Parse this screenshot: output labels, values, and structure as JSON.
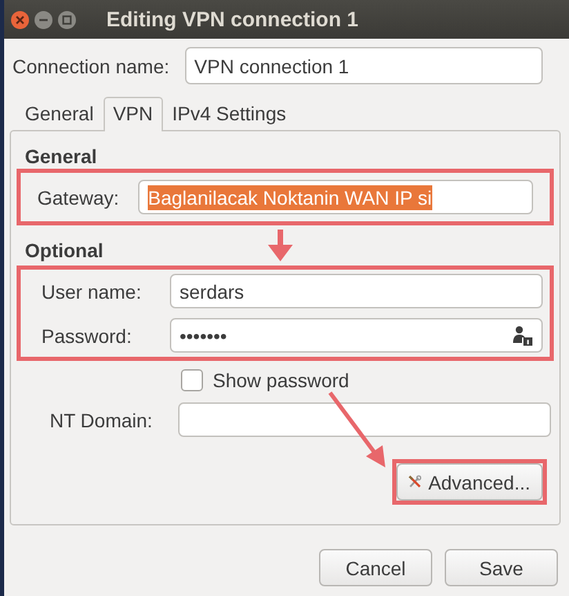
{
  "window": {
    "title": "Editing VPN connection 1"
  },
  "connection_name": {
    "label": "Connection name:",
    "value": "VPN connection 1"
  },
  "tabs": [
    {
      "label": "General",
      "selected": false
    },
    {
      "label": "VPN",
      "selected": true
    },
    {
      "label": "IPv4 Settings",
      "selected": false
    }
  ],
  "general": {
    "heading": "General",
    "highlighted": true,
    "gateway": {
      "label": "Gateway:",
      "value": "Baglanilacak Noktanin WAN IP si",
      "text_selected": true
    }
  },
  "optional": {
    "heading": "Optional",
    "highlighted": true,
    "user_name": {
      "label": "User name:",
      "value": "serdars"
    },
    "password": {
      "label": "Password:",
      "value": "•••••••"
    },
    "show_password": {
      "label": "Show password",
      "checked": false
    },
    "nt_domain": {
      "label": "NT Domain:"
    }
  },
  "advanced_button": {
    "label": "Advanced...",
    "highlighted": true
  },
  "buttons": [
    "Cancel",
    "Save"
  ]
}
